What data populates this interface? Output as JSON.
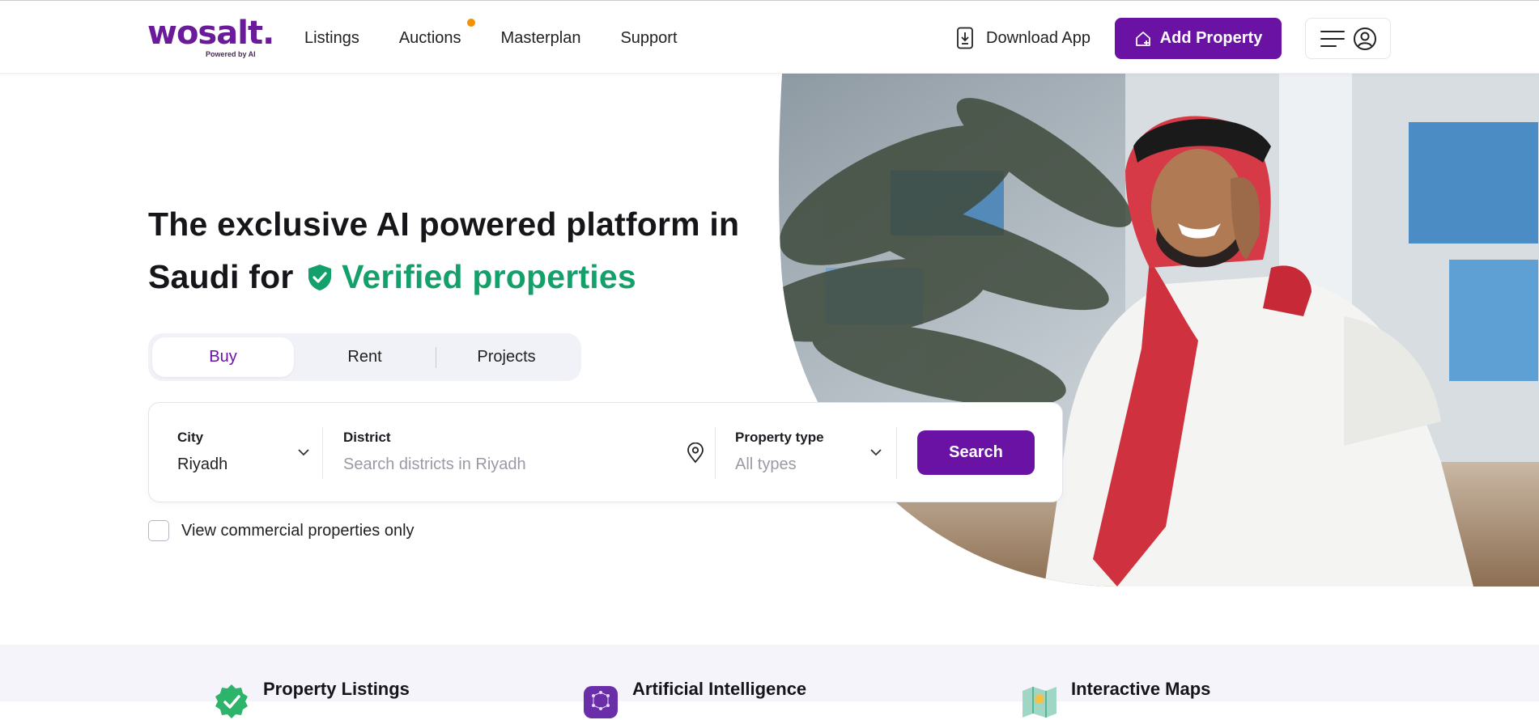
{
  "brand": {
    "logo_text": "wosalt.",
    "tagline": "Powered by AI",
    "accent": "#6a12a3",
    "verified_color": "#14a06a",
    "notification_color": "#f39200"
  },
  "nav": {
    "items": [
      {
        "label": "Listings"
      },
      {
        "label": "Auctions",
        "has_notification": true
      },
      {
        "label": "Masterplan"
      },
      {
        "label": "Support"
      }
    ],
    "download_label": "Download App",
    "add_property_label": "Add Property"
  },
  "hero": {
    "title_part1": "The exclusive AI powered platform in Saudi for",
    "title_highlight": "Verified properties"
  },
  "tabs": [
    {
      "label": "Buy",
      "active": true
    },
    {
      "label": "Rent"
    },
    {
      "label": "Projects"
    }
  ],
  "search": {
    "city_label": "City",
    "city_value": "Riyadh",
    "district_label": "District",
    "district_placeholder": "Search districts in Riyadh",
    "type_label": "Property type",
    "type_placeholder": "All types",
    "button_label": "Search"
  },
  "commercial_label": "View commercial properties only",
  "commercial_checked": false,
  "features": [
    {
      "title": "Property Listings",
      "icon": "verified-badge-icon"
    },
    {
      "title": "Artificial Intelligence",
      "icon": "ai-chip-icon"
    },
    {
      "title": "Interactive Maps",
      "icon": "map-icon"
    }
  ]
}
